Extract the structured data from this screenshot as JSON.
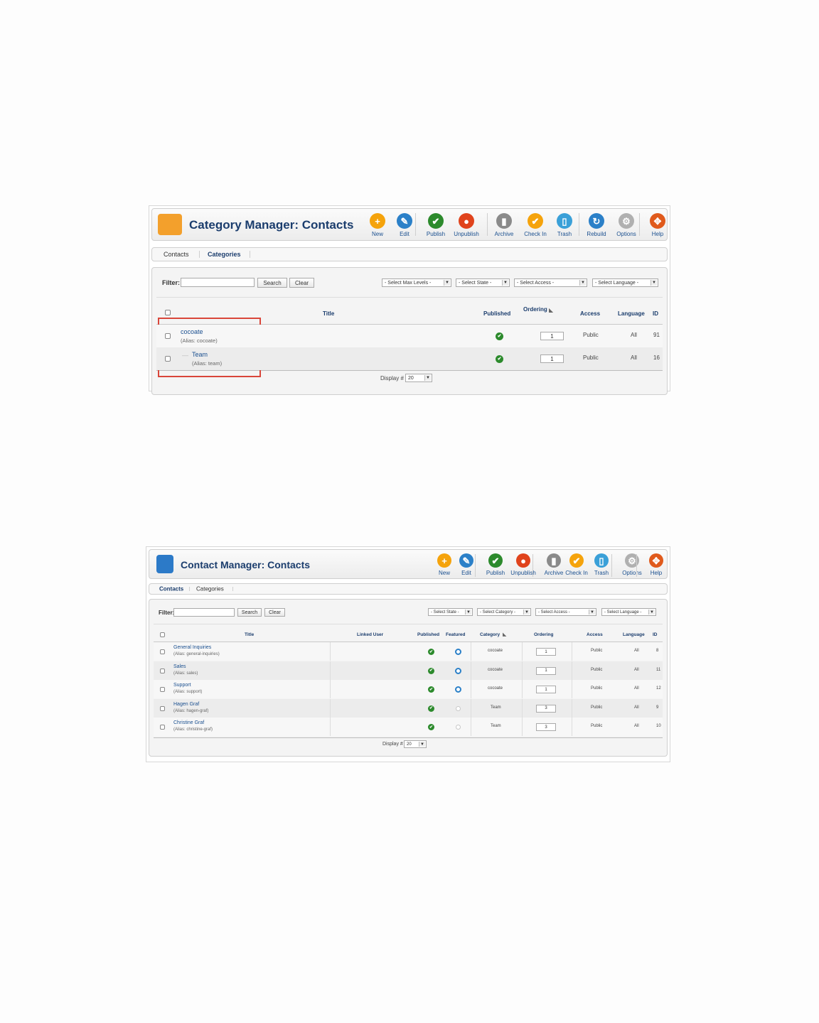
{
  "category_manager": {
    "title": "Category Manager: Contacts",
    "toolbar": [
      {
        "label": "New",
        "icon": "new-icon",
        "color": "#f5a30c",
        "glyph": "+"
      },
      {
        "label": "Edit",
        "icon": "edit-icon",
        "color": "#2b80c8",
        "glyph": "✎"
      },
      {
        "label": "Publish",
        "icon": "publish-icon",
        "color": "#2c8a2c",
        "glyph": "✔"
      },
      {
        "label": "Unpublish",
        "icon": "unpublish-icon",
        "color": "#e0431c",
        "glyph": "●"
      },
      {
        "label": "Archive",
        "icon": "archive-icon",
        "color": "#8a8a8a",
        "glyph": "▮"
      },
      {
        "label": "Check In",
        "icon": "check-in-icon",
        "color": "#f5a30c",
        "glyph": "✔"
      },
      {
        "label": "Trash",
        "icon": "trash-icon",
        "color": "#3aa0d8",
        "glyph": "▯"
      },
      {
        "label": "Rebuild",
        "icon": "rebuild-icon",
        "color": "#2b80c8",
        "glyph": "↻"
      },
      {
        "label": "Options",
        "icon": "options-icon",
        "color": "#b0b0b0",
        "glyph": "⚙"
      },
      {
        "label": "Help",
        "icon": "help-icon",
        "color": "#e05a1c",
        "glyph": "✥"
      }
    ],
    "tabs": [
      "Contacts",
      "Categories"
    ],
    "active_tab": 1,
    "filter_label": "Filter:",
    "search_button": "Search",
    "clear_button": "Clear",
    "selects": [
      "- Select Max Levels -",
      "- Select State -",
      "- Select Access -",
      "- Select Language -"
    ],
    "columns": {
      "title": "Title",
      "published": "Published",
      "ordering": "Ordering",
      "access": "Access",
      "language": "Language",
      "id": "ID"
    },
    "rows": [
      {
        "title": "cocoate",
        "alias": "(Alias: cocoate)",
        "ordering": "1",
        "access": "Public",
        "language": "All",
        "id": "91"
      },
      {
        "title": "Team",
        "prefix": "—",
        "alias": "(Alias: team)",
        "ordering": "1",
        "access": "Public",
        "language": "All",
        "id": "16"
      }
    ],
    "display_label": "Display #",
    "display_value": "20",
    "highlight_color": "#d9463a"
  },
  "contact_manager": {
    "title": "Contact Manager: Contacts",
    "toolbar": [
      {
        "label": "New",
        "icon": "new-icon",
        "color": "#f5a30c",
        "glyph": "+"
      },
      {
        "label": "Edit",
        "icon": "edit-icon",
        "color": "#2b80c8",
        "glyph": "✎"
      },
      {
        "label": "Publish",
        "icon": "publish-icon",
        "color": "#2c8a2c",
        "glyph": "✔"
      },
      {
        "label": "Unpublish",
        "icon": "unpublish-icon",
        "color": "#e0431c",
        "glyph": "●"
      },
      {
        "label": "Archive",
        "icon": "archive-icon",
        "color": "#8a8a8a",
        "glyph": "▮"
      },
      {
        "label": "Check In",
        "icon": "check-in-icon",
        "color": "#f5a30c",
        "glyph": "✔"
      },
      {
        "label": "Trash",
        "icon": "trash-icon",
        "color": "#3aa0d8",
        "glyph": "▯"
      },
      {
        "label": "Options",
        "icon": "options-icon",
        "color": "#b0b0b0",
        "glyph": "⚙"
      },
      {
        "label": "Help",
        "icon": "help-icon",
        "color": "#e05a1c",
        "glyph": "✥"
      }
    ],
    "tabs": [
      "Contacts",
      "Categories"
    ],
    "active_tab": 0,
    "filter_label": "Filter:",
    "search_button": "Search",
    "clear_button": "Clear",
    "selects": [
      "- Select State -",
      "- Select Category -",
      "- Select Access -",
      "- Select Language -"
    ],
    "columns": {
      "title": "Title",
      "linked_user": "Linked User",
      "published": "Published",
      "featured": "Featured",
      "category": "Category",
      "ordering": "Ordering",
      "access": "Access",
      "language": "Language",
      "id": "ID"
    },
    "rows": [
      {
        "title": "General Inquiries",
        "alias": "(Alias: general-inquiries)",
        "featured": true,
        "category": "cocoate",
        "ordering": "1",
        "access": "Public",
        "language": "All",
        "id": "8"
      },
      {
        "title": "Sales",
        "alias": "(Alias: sales)",
        "featured": true,
        "category": "cocoate",
        "ordering": "1",
        "access": "Public",
        "language": "All",
        "id": "11"
      },
      {
        "title": "Support",
        "alias": "(Alias: support)",
        "featured": true,
        "category": "cocoate",
        "ordering": "1",
        "access": "Public",
        "language": "All",
        "id": "12"
      },
      {
        "title": "Hagen Graf",
        "alias": "(Alias: hagen-graf)",
        "featured": false,
        "category": "Team",
        "ordering": "3",
        "access": "Public",
        "language": "All",
        "id": "9"
      },
      {
        "title": "Christine Graf",
        "alias": "(Alias: christine-graf)",
        "featured": false,
        "category": "Team",
        "ordering": "3",
        "access": "Public",
        "language": "All",
        "id": "10"
      }
    ],
    "display_label": "Display #",
    "display_value": "20"
  }
}
